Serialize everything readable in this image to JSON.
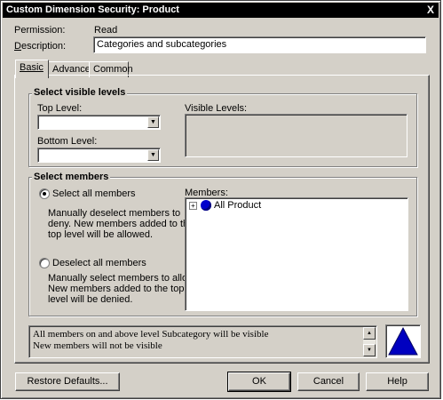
{
  "window": {
    "title": "Custom Dimension Security: Product",
    "close_glyph": "X"
  },
  "permission": {
    "label": "Permission:",
    "value": "Read"
  },
  "description": {
    "label": "Description:",
    "value": "Categories and subcategories"
  },
  "tabs": [
    {
      "label": "Basic",
      "active": true
    },
    {
      "label": "Advanced",
      "active": false
    },
    {
      "label": "Common",
      "active": false
    }
  ],
  "visible_levels": {
    "title": "Select visible levels",
    "top_level_label": "Top Level:",
    "top_level_value": "",
    "bottom_level_label": "Bottom Level:",
    "bottom_level_value": "",
    "visible_levels_label": "Visible Levels:"
  },
  "members": {
    "title": "Select members",
    "select_all_label": "Select all members",
    "select_all_checked": true,
    "select_all_desc": "Manually deselect members to deny. New members added to the top level will be allowed.",
    "deselect_all_label": "Deselect all members",
    "deselect_all_checked": false,
    "deselect_all_desc": "Manually select members to allow. New members added to the top level will be denied.",
    "members_label": "Members:",
    "tree": [
      {
        "label": "All Product",
        "expander": "+"
      }
    ]
  },
  "status_message": {
    "line1": "All members on and above level Subcategory will be visible",
    "line2": "New members will not be visible"
  },
  "icons": {
    "indicator": "triangle-icon",
    "indicator_color": "#0000c0",
    "node_color": "#0000cc"
  },
  "buttons": {
    "restore": "Restore Defaults...",
    "ok": "OK",
    "cancel": "Cancel",
    "help": "Help"
  }
}
